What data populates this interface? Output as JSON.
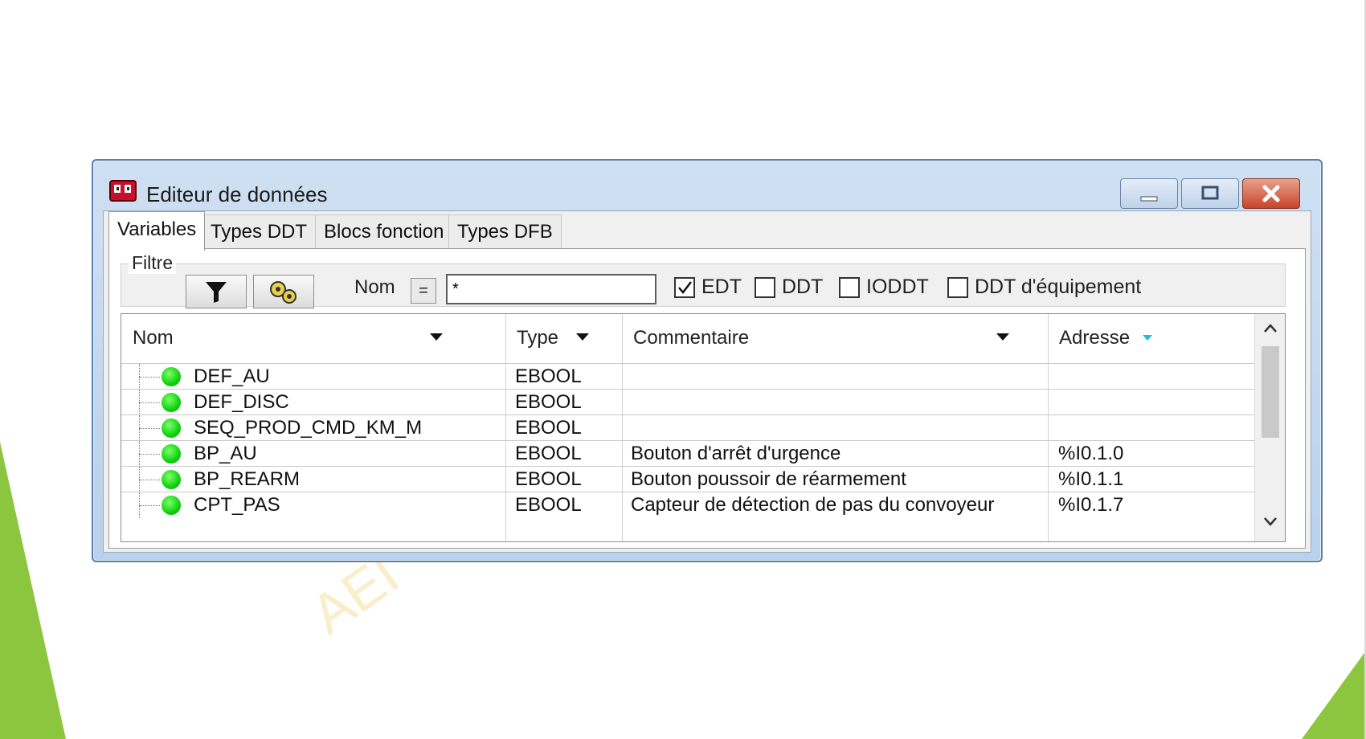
{
  "window": {
    "title": "Editeur de données"
  },
  "tabs": [
    {
      "label": "Variables",
      "active": true
    },
    {
      "label": "Types DDT",
      "active": false
    },
    {
      "label": "Blocs fonction",
      "active": false
    },
    {
      "label": "Types DFB",
      "active": false
    }
  ],
  "filter": {
    "group_label": "Filtre",
    "nom_label": "Nom",
    "operator": "=",
    "nom_value": "*",
    "checkboxes": [
      {
        "label": "EDT",
        "checked": true
      },
      {
        "label": "DDT",
        "checked": false
      },
      {
        "label": "IODDT",
        "checked": false
      },
      {
        "label": "DDT d'équipement",
        "checked": false
      }
    ]
  },
  "table": {
    "columns": [
      "Nom",
      "Type",
      "Commentaire",
      "Adresse"
    ],
    "rows": [
      {
        "nom": "DEF_AU",
        "type": "EBOOL",
        "commentaire": "",
        "adresse": ""
      },
      {
        "nom": "DEF_DISC",
        "type": "EBOOL",
        "commentaire": "",
        "adresse": ""
      },
      {
        "nom": "SEQ_PROD_CMD_KM_M",
        "type": "EBOOL",
        "commentaire": "",
        "adresse": ""
      },
      {
        "nom": "BP_AU",
        "type": "EBOOL",
        "commentaire": "Bouton d'arrêt d'urgence",
        "adresse": "%I0.1.0"
      },
      {
        "nom": "BP_REARM",
        "type": "EBOOL",
        "commentaire": "Bouton poussoir de réarmement",
        "adresse": "%I0.1.1"
      },
      {
        "nom": "CPT_PAS",
        "type": "EBOOL",
        "commentaire": "Capteur de détection de pas du convoyeur",
        "adresse": "%I0.1.7"
      }
    ]
  },
  "watermark": "AEI",
  "colors": {
    "title_bar": "#b9d1ec",
    "close_button": "#c7452b",
    "status_dot": "#0fd10f",
    "sort_active_arrow": "#29b6e8",
    "deco_green": "#8cc63f"
  },
  "icons": [
    "app-icon",
    "filter-icon",
    "gears-icon",
    "minimize-icon",
    "maximize-icon",
    "close-icon",
    "chevron-up-icon",
    "chevron-down-icon"
  ]
}
